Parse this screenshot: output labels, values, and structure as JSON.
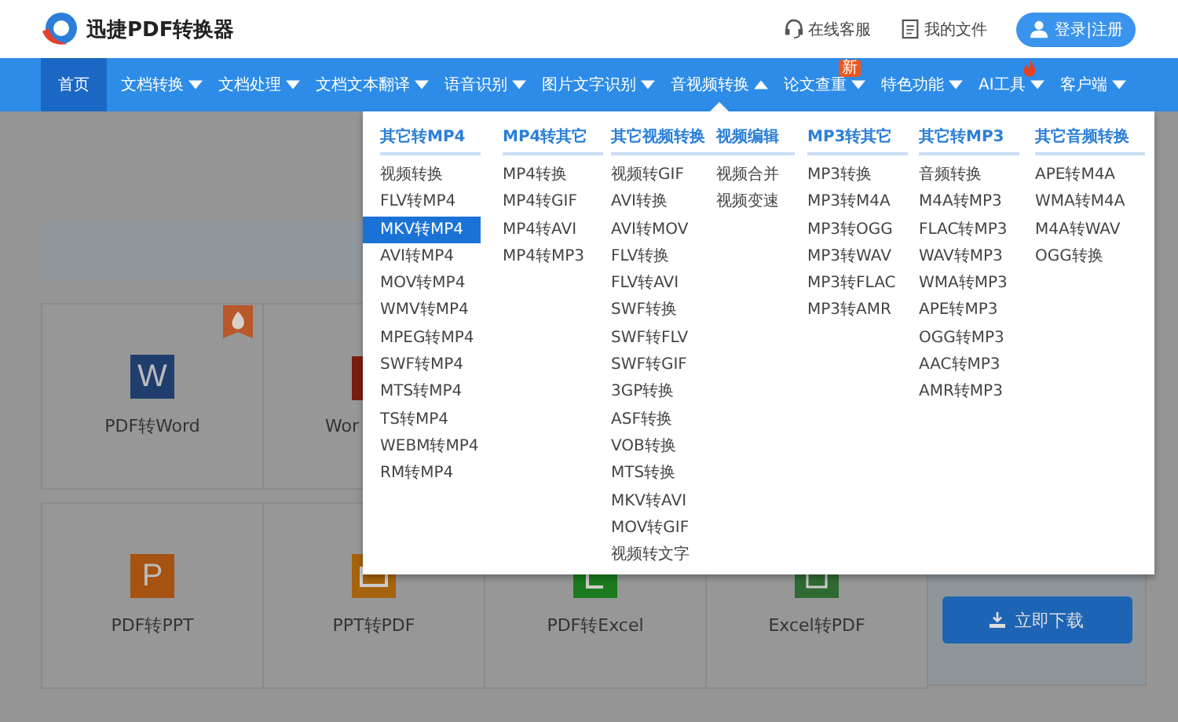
{
  "header": {
    "logo_text": "迅捷PDF转换器",
    "links": [
      {
        "label": "在线客服",
        "kind": "headset"
      },
      {
        "label": "我的文件",
        "kind": "file"
      }
    ],
    "login_button": "登录|注册"
  },
  "nav": [
    {
      "label": "首页",
      "kind": "link",
      "selected": true,
      "expanded": false,
      "hot": false
    },
    {
      "label": "文档转换",
      "kind": "menu",
      "selected": false,
      "expanded": false,
      "hot": false
    },
    {
      "label": "文档处理",
      "kind": "menu",
      "selected": false,
      "expanded": false,
      "hot": false
    },
    {
      "label": "文档文本翻译",
      "kind": "menu",
      "selected": false,
      "expanded": false,
      "hot": false
    },
    {
      "label": "语音识别",
      "kind": "menu",
      "selected": false,
      "expanded": false,
      "hot": false
    },
    {
      "label": "图片文字识别",
      "kind": "menu",
      "selected": false,
      "expanded": false,
      "hot": false
    },
    {
      "label": "音视频转换",
      "kind": "menu",
      "selected": false,
      "expanded": true,
      "hot": false
    },
    {
      "label": "论文查重",
      "kind": "menu",
      "selected": false,
      "expanded": false,
      "hot": false,
      "badge": "新"
    },
    {
      "label": "特色功能",
      "kind": "menu",
      "selected": false,
      "expanded": false,
      "hot": false
    },
    {
      "label": "AI工具",
      "kind": "menu",
      "selected": false,
      "expanded": false,
      "hot": true
    },
    {
      "label": "客户端",
      "kind": "menu",
      "selected": false,
      "expanded": false,
      "hot": false
    }
  ],
  "dropdown": {
    "columns": [
      {
        "title": "其它转MP4",
        "items": [
          {
            "label": "视频转换",
            "selected": false
          },
          {
            "label": "FLV转MP4",
            "selected": false
          },
          {
            "label": "MKV转MP4",
            "selected": true
          },
          {
            "label": "AVI转MP4",
            "selected": false
          },
          {
            "label": "MOV转MP4",
            "selected": false
          },
          {
            "label": "WMV转MP4",
            "selected": false
          },
          {
            "label": "MPEG转MP4",
            "selected": false
          },
          {
            "label": "SWF转MP4",
            "selected": false
          },
          {
            "label": "MTS转MP4",
            "selected": false
          },
          {
            "label": "TS转MP4",
            "selected": false
          },
          {
            "label": "WEBM转MP4",
            "selected": false
          },
          {
            "label": "RM转MP4",
            "selected": false
          }
        ]
      },
      {
        "title": "MP4转其它",
        "items": [
          {
            "label": "MP4转换",
            "selected": false
          },
          {
            "label": "MP4转GIF",
            "selected": false
          },
          {
            "label": "MP4转AVI",
            "selected": false
          },
          {
            "label": "MP4转MP3",
            "selected": false
          }
        ]
      },
      {
        "title": "其它视频转换",
        "items": [
          {
            "label": "视频转GIF",
            "selected": false
          },
          {
            "label": "AVI转换",
            "selected": false
          },
          {
            "label": "AVI转MOV",
            "selected": false
          },
          {
            "label": "FLV转换",
            "selected": false
          },
          {
            "label": "FLV转AVI",
            "selected": false
          },
          {
            "label": "SWF转换",
            "selected": false
          },
          {
            "label": "SWF转FLV",
            "selected": false
          },
          {
            "label": "SWF转GIF",
            "selected": false
          },
          {
            "label": "3GP转换",
            "selected": false
          },
          {
            "label": "ASF转换",
            "selected": false
          },
          {
            "label": "VOB转换",
            "selected": false
          },
          {
            "label": "MTS转换",
            "selected": false
          },
          {
            "label": "MKV转AVI",
            "selected": false
          },
          {
            "label": "MOV转GIF",
            "selected": false
          },
          {
            "label": "视频转文字",
            "selected": false
          }
        ]
      },
      {
        "title": "视频编辑",
        "items": [
          {
            "label": "视频合并",
            "selected": false
          },
          {
            "label": "视频变速",
            "selected": false
          }
        ]
      },
      {
        "title": "MP3转其它",
        "items": [
          {
            "label": "MP3转换",
            "selected": false
          },
          {
            "label": "MP3转M4A",
            "selected": false
          },
          {
            "label": "MP3转OGG",
            "selected": false
          },
          {
            "label": "MP3转WAV",
            "selected": false
          },
          {
            "label": "MP3转FLAC",
            "selected": false
          },
          {
            "label": "MP3转AMR",
            "selected": false
          }
        ]
      },
      {
        "title": "其它转MP3",
        "items": [
          {
            "label": "音频转换",
            "selected": false
          },
          {
            "label": "M4A转MP3",
            "selected": false
          },
          {
            "label": "FLAC转MP3",
            "selected": false
          },
          {
            "label": "WAV转MP3",
            "selected": false
          },
          {
            "label": "WMA转MP3",
            "selected": false
          },
          {
            "label": "APE转MP3",
            "selected": false
          },
          {
            "label": "OGG转MP3",
            "selected": false
          },
          {
            "label": "AAC转MP3",
            "selected": false
          },
          {
            "label": "AMR转MP3",
            "selected": false
          }
        ]
      },
      {
        "title": "其它音频转换",
        "items": [
          {
            "label": "APE转M4A",
            "selected": false
          },
          {
            "label": "WMA转M4A",
            "selected": false
          },
          {
            "label": "M4A转WAV",
            "selected": false
          },
          {
            "label": "OGG转换",
            "selected": false
          }
        ]
      }
    ]
  },
  "tools": {
    "rows": [
      [
        {
          "label": "PDF转Word",
          "kind": "word",
          "icon_letter": "W",
          "hot": true
        },
        {
          "label": "Wor",
          "kind": "red",
          "hot": false
        }
      ],
      [
        {
          "label": "PDF转PPT",
          "kind": "ppt",
          "icon_letter": "P",
          "hot": false
        },
        {
          "label": "PPT转PDF",
          "kind": "ppt2pdf",
          "hot": false
        },
        {
          "label": "PDF转Excel",
          "kind": "excel",
          "hot": false
        },
        {
          "label": "Excel转PDF",
          "kind": "excel2pdf",
          "hot": false
        }
      ]
    ],
    "download_button": "立即下载"
  }
}
